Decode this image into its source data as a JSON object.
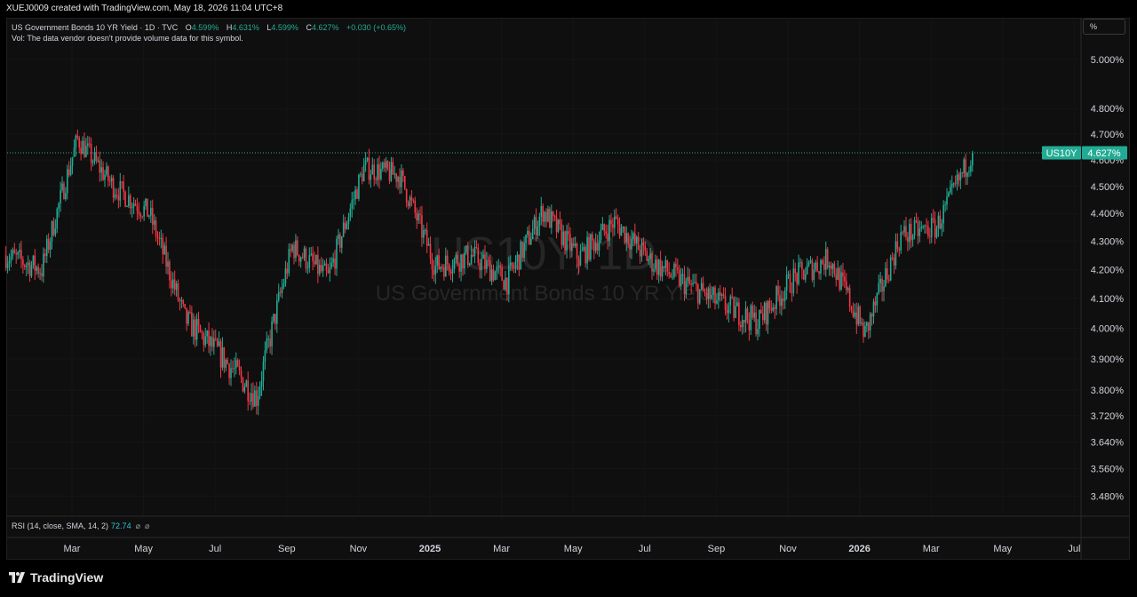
{
  "header": {
    "attribution": "XUEJ0009 created with TradingView.com, May 18, 2026 11:04 UTC+8"
  },
  "legend": {
    "title": "US Government Bonds 10 YR Yield · 1D · TVC",
    "open_key": "O",
    "open": "4.599%",
    "high_key": "H",
    "high": "4.631%",
    "low_key": "L",
    "low": "4.599%",
    "close_key": "C",
    "close": "4.627%",
    "change": "+0.030 (+0.65%)",
    "volume_note": "Vol: The data vendor doesn't provide volume data for this symbol."
  },
  "unit_toggle": {
    "label": "%"
  },
  "watermark": {
    "symbol": "US10Y, 1D",
    "name": "US Government Bonds 10 YR Yield"
  },
  "price_tag": {
    "symbol": "US10Y",
    "value": "4.627%",
    "color": "#22ab94"
  },
  "rsi": {
    "label": "RSI (14, close, SMA, 14, 2)",
    "value": "72.74",
    "sym1": "⌀",
    "sym2": "⌀",
    "color": "#2ec4d9"
  },
  "colors": {
    "up": "#22ab94",
    "down": "#f23645",
    "background": "#0f0f0f"
  },
  "brand": {
    "name": "TradingView"
  },
  "chart_data": {
    "type": "candlestick",
    "y_scale": "log",
    "ylim": [
      3.43,
      5.1
    ],
    "y_ticks": [
      "5.000%",
      "4.800%",
      "4.700%",
      "4.600%",
      "4.500%",
      "4.400%",
      "4.300%",
      "4.200%",
      "4.100%",
      "4.000%",
      "3.900%",
      "3.800%",
      "3.720%",
      "3.640%",
      "3.560%",
      "3.480%"
    ],
    "x_ticks": [
      {
        "label": "Mar",
        "month": 1,
        "bold": false
      },
      {
        "label": "May",
        "month": 3,
        "bold": false
      },
      {
        "label": "Jul",
        "month": 5,
        "bold": false
      },
      {
        "label": "Sep",
        "month": 7,
        "bold": false
      },
      {
        "label": "Nov",
        "month": 9,
        "bold": false
      },
      {
        "label": "2025",
        "month": 11,
        "bold": true
      },
      {
        "label": "Mar",
        "month": 13,
        "bold": false
      },
      {
        "label": "May",
        "month": 15,
        "bold": false
      },
      {
        "label": "Jul",
        "month": 17,
        "bold": false
      },
      {
        "label": "Sep",
        "month": 19,
        "bold": false
      },
      {
        "label": "Nov",
        "month": 21,
        "bold": false
      },
      {
        "label": "2026",
        "month": 23,
        "bold": true
      },
      {
        "label": "Mar",
        "month": 25,
        "bold": false
      },
      {
        "label": "May",
        "month": 27,
        "bold": false
      },
      {
        "label": "Jul",
        "month": 29,
        "bold": false
      }
    ],
    "last_close": 4.627,
    "series_monthly_closes": [
      {
        "period": "2024-02",
        "close": 4.25
      },
      {
        "period": "2024-03",
        "close": 4.2
      },
      {
        "period": "2024-04",
        "close": 4.68
      },
      {
        "period": "2024-05",
        "close": 4.5
      },
      {
        "period": "2024-06",
        "close": 4.4
      },
      {
        "period": "2024-07",
        "close": 4.03
      },
      {
        "period": "2024-08",
        "close": 3.91
      },
      {
        "period": "2024-09",
        "close": 3.78
      },
      {
        "period": "2024-10",
        "close": 4.28
      },
      {
        "period": "2024-11",
        "close": 4.17
      },
      {
        "period": "2024-12",
        "close": 4.57
      },
      {
        "period": "2025-01",
        "close": 4.54
      },
      {
        "period": "2025-02",
        "close": 4.21
      },
      {
        "period": "2025-03",
        "close": 4.25
      },
      {
        "period": "2025-04",
        "close": 4.16
      },
      {
        "period": "2025-05",
        "close": 4.41
      },
      {
        "period": "2025-06",
        "close": 4.24
      },
      {
        "period": "2025-07",
        "close": 4.37
      },
      {
        "period": "2025-08",
        "close": 4.23
      },
      {
        "period": "2025-09",
        "close": 4.15
      },
      {
        "period": "2025-10",
        "close": 4.08
      },
      {
        "period": "2025-11",
        "close": 4.02
      },
      {
        "period": "2025-12",
        "close": 4.17
      },
      {
        "period": "2026-01",
        "close": 4.24
      },
      {
        "period": "2026-02",
        "close": 3.98
      },
      {
        "period": "2026-03",
        "close": 4.32
      },
      {
        "period": "2026-04",
        "close": 4.35
      },
      {
        "period": "2026-05",
        "close": 4.627
      }
    ]
  }
}
